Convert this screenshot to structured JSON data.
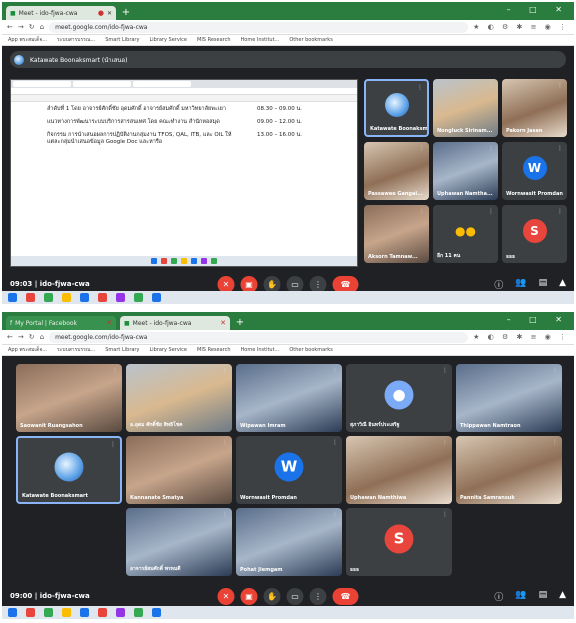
{
  "top": {
    "tab_title": "Meet - ido-fjwa-cwa",
    "url": "meet.google.com/ido-fjwa-cwa",
    "bookmarks": [
      "App พระสมเด็จ...",
      "ระบบสารบรรณ...",
      "Smart Library",
      "Library Service",
      "MIS Research",
      "Home Institut...",
      "Other bookmarks"
    ],
    "banner_name": "Katawate Boonaksmart (นำเสนอ)",
    "doc_rows": [
      {
        "text": "ลำดับที่ 1 โดย อาจารย์ศักดิ์ชัย อุดมศักดิ์ อาจารย์สมศักดิ์ มหาวิทยาลัยพะเยา",
        "time": "08.30 – 09.00 น."
      },
      {
        "text": "แนวทางการพัฒนาระบบบริการสารสนเทศ โดย คณะทำงาน สำนักหอสมุด",
        "time": "09.00 – 12.00 น."
      },
      {
        "text": "กิจกรรม การนำเสนอผลการปฏิบัติงานกลุ่มงาน TFOS, QAL, ITB, และ OIL ให้แต่ละกลุ่มนำเสนอข้อมูล Google Doc และหารือ",
        "time": "13.00 – 16.00 น."
      }
    ],
    "tiles": [
      {
        "name": "Katawate Boonaksma...",
        "kind": "avatar"
      },
      {
        "name": "Nongluck Sirinam...",
        "kind": "photo"
      },
      {
        "name": "Pakorn Jasan",
        "kind": "photo"
      },
      {
        "name": "Passawee Gangai...",
        "kind": "photo"
      },
      {
        "name": "Uphawan Namtha...",
        "kind": "photo"
      },
      {
        "name": "Wornwasit Promdan",
        "kind": "letter",
        "letter": "W",
        "color": "#1a73e8"
      },
      {
        "name": "Aksorn Tamnaw...",
        "kind": "photo"
      },
      {
        "name": "อีก 11 คน",
        "kind": "more"
      },
      {
        "name": "sss",
        "kind": "letter",
        "letter": "S",
        "color": "#e8453c"
      }
    ],
    "meeting_time": "09:03",
    "meeting_code": "ido-fjwa-cwa"
  },
  "bottom": {
    "tab_title": "My Portal | Facebook",
    "tab_title_2": "Meet - ido-fjwa-cwa",
    "url": "meet.google.com/ido-fjwa-cwa",
    "tiles": [
      {
        "name": "Saowanit Ruangsahon",
        "kind": "photo"
      },
      {
        "name": "อ.อุดม ศักดิ์ชัย สิทธิโชค",
        "kind": "photo"
      },
      {
        "name": "Wipawan Imram",
        "kind": "photo"
      },
      {
        "name": "สุภาวิณี อินทร์ประเสริฐ",
        "kind": "avatar-default"
      },
      {
        "name": "Thippawan Namtraon",
        "kind": "photo"
      },
      {
        "name": "Katawate Boonaksmart",
        "kind": "avatar"
      },
      {
        "name": "Kannanate Smatya",
        "kind": "photo"
      },
      {
        "name": "Wornwasit Promdan",
        "kind": "letter",
        "letter": "W",
        "color": "#1a73e8"
      },
      {
        "name": "Uphawan Namthiwa",
        "kind": "photo"
      },
      {
        "name": "Pannita Samransuk",
        "kind": "photo"
      },
      {
        "name": "อาจารย์สมศักดิ์ พรหมดี",
        "kind": "photo"
      },
      {
        "name": "Pohat Jiemgam",
        "kind": "photo"
      },
      {
        "name": "sss",
        "kind": "letter",
        "letter": "S",
        "color": "#e8453c"
      }
    ],
    "meeting_time": "09:00",
    "meeting_code": "ido-fjwa-cwa"
  }
}
